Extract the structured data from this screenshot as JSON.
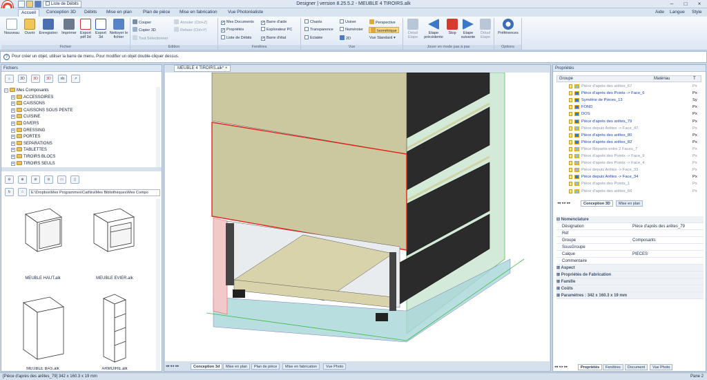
{
  "titlebar": {
    "title": "Designer | version 8.25.5.2 - MEUBLE 4 TIROIRS.alk",
    "qa_label": "Liste de Débits"
  },
  "menu_right": [
    "Aide",
    "Langue",
    "Style"
  ],
  "tabs": [
    "Accueil",
    "Conception 3D",
    "Débits",
    "Mise en plan",
    "Plan de pièce",
    "Mise en fabrication",
    "Vue Photoréaliste"
  ],
  "ribbon": {
    "fichier": {
      "label": "Fichier",
      "buttons": [
        "Nouveau",
        "Ouvrir",
        "Enregistrer",
        "Imprimer",
        "Export pdf 3d",
        "Export 3d",
        "Nettoyer le fichier"
      ]
    },
    "edition": {
      "label": "Edition",
      "couper": "Couper",
      "copier": "Copier 3D",
      "tout": "Tout Sélectionner",
      "annuler": "Annuler (Ctrl+Z)",
      "refaire": "Refaire (Ctrl+Y)"
    },
    "fenetres": {
      "label": "Fenêtres",
      "items": [
        "Mes Documents",
        "Propriétés",
        "Liste de Débits",
        "Barre d'aide",
        "Explorateur PC",
        "Barre d'état"
      ]
    },
    "vue": {
      "label": "Vue",
      "items": [
        "Chants",
        "Transparence",
        "Eclatée",
        "Usiner",
        "Numéroter",
        "2D",
        "Perspective",
        "Isométrique",
        "Vue Standard"
      ]
    },
    "jouer": {
      "label": "Jouer en mode pas à pas",
      "buttons": [
        "Détail Etape",
        "Etape précédente",
        "Stop",
        "Etape suivante",
        "Détail Etape"
      ]
    },
    "options": {
      "label": "Options",
      "button": "Préférences"
    }
  },
  "infobar": {
    "text": "Pour créer un objet, utiliser la barre de menu. Pour modifier un objet double-cliquer dessus."
  },
  "fichiers": {
    "title": "Fichiers",
    "root": "Mes Composants",
    "folders": [
      "ACCESSOIRES",
      "CAISSONS",
      "CAISSONS SOUS PENTE",
      "CUISINE",
      "DIVERS",
      "DRESSING",
      "PORTES",
      "SEPARATIONS",
      "TABLETTES",
      "TIROIRS BLOCS",
      "TIROIRS SEULS"
    ],
    "path": "E:\\Dropbox\\Mes Programmes\\Cad\\tra\\Mes Bibliothèques\\Mes Compo",
    "thumbnails": [
      "MEUBLE HAUT.alk",
      "MEUBLE EVIER.alk",
      "MEUBLE BAS.alk",
      "ARMOIRE.alk"
    ]
  },
  "viewport": {
    "doc_tab": "MEUBLE 4 TIROIRS.alk*",
    "bottom_tabs": [
      "Conception 3d",
      "Mise en plan",
      "Plan de pièce",
      "Mise en fabrication",
      "Vue Photo"
    ]
  },
  "proprietes": {
    "title": "Propriétés",
    "columns": [
      "Groupe",
      "Matériau",
      "T"
    ],
    "rows": [
      {
        "name": "Pièce d'après des arêtes_67",
        "mat": "Px",
        "grey": true
      },
      {
        "name": "Pièce d'après des Points -> Face_6",
        "mat": "Px",
        "grey": false
      },
      {
        "name": "Symétrie de Pièces_13",
        "mat": "Sy",
        "grey": false
      },
      {
        "name": "FOND",
        "mat": "Px",
        "grey": false
      },
      {
        "name": "DOS",
        "mat": "Px",
        "grey": false
      },
      {
        "name": "Pièce d'après des arêtes_79",
        "mat": "Px",
        "grey": false
      },
      {
        "name": "Pièce depuis Arêtes -> Face_47",
        "mat": "Px",
        "grey": true
      },
      {
        "name": "Pièce d'après des arêtes_80",
        "mat": "Px",
        "grey": false
      },
      {
        "name": "Pièce d'après des arêtes_82",
        "mat": "Px",
        "grey": false
      },
      {
        "name": "Pièce Répartis entre 2 Faces_7",
        "mat": "Px",
        "grey": true
      },
      {
        "name": "Pièce d'après des Points -> Face_9",
        "mat": "Px",
        "grey": true
      },
      {
        "name": "Pièce d'après des Points -> Face_4",
        "mat": "Px",
        "grey": true
      },
      {
        "name": "Pièce depuis Arêtes -> Face_33",
        "mat": "Px",
        "grey": true
      },
      {
        "name": "Pièce depuis Arêtes -> Face_34",
        "mat": "Px",
        "grey": false
      },
      {
        "name": "Pièce d'après des Points_1",
        "mat": "Px",
        "grey": true
      },
      {
        "name": "Pièce d'après des arêtes_66",
        "mat": "Px",
        "grey": true
      }
    ],
    "tree_tabs": [
      "Conception 3D",
      "Mise en plan"
    ],
    "sections": {
      "nomenclature": "Nomenclature",
      "aspect": "Aspect",
      "fabrication": "Propriétés de Fabrication",
      "famille": "Famille",
      "couts": "Coûts",
      "parametres": "Paramètres : 342 x 160.3 x 19 mm"
    },
    "fields": [
      {
        "k": "Désignation",
        "v": "Pièce d'après des arêtes_79"
      },
      {
        "k": "Réf",
        "v": ""
      },
      {
        "k": "Groupe",
        "v": "Composants"
      },
      {
        "k": "SousGroupe",
        "v": ""
      },
      {
        "k": "Calque",
        "v": "PIECES"
      },
      {
        "k": "Commentaire",
        "v": ""
      }
    ],
    "bottom_tabs": [
      "Propriétés",
      "Fenêtres",
      "Document",
      "Vue Photo"
    ]
  },
  "status": {
    "left": "[Pièce d'après des arêtes_79] 342 x 160.3 x 19 mm",
    "right": "Pane 2"
  }
}
